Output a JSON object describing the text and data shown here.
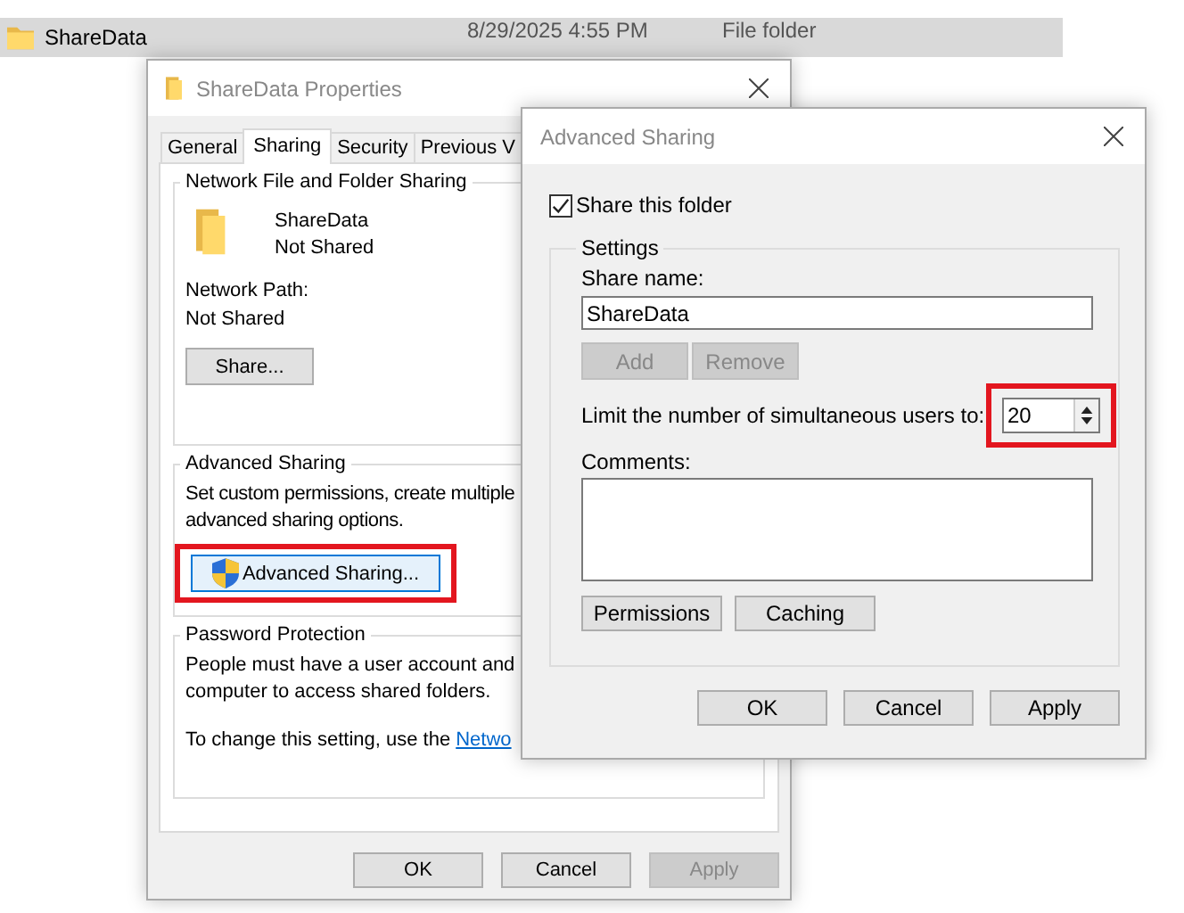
{
  "explorer_row": {
    "name": "ShareData",
    "date": "8/29/2025 4:55 PM",
    "type": "File folder",
    "selected": true
  },
  "properties_window": {
    "title": "ShareData Properties",
    "active": false,
    "tabs": [
      {
        "label": "General",
        "selected": false
      },
      {
        "label": "Sharing",
        "selected": true
      },
      {
        "label": "Security",
        "selected": false
      },
      {
        "label": "Previous V",
        "selected": false
      }
    ],
    "network_group": {
      "title": "Network File and Folder Sharing",
      "folder_name": "ShareData",
      "status": "Not Shared",
      "path_label": "Network Path:",
      "path_value": "Not Shared",
      "button": "Share..."
    },
    "advanced_group": {
      "title": "Advanced Sharing",
      "description": [
        "Set custom permissions, create multiple",
        "advanced sharing options."
      ],
      "button": "Advanced Sharing...",
      "highlighted": true
    },
    "password_group": {
      "title": "Password Protection",
      "description": [
        "People must have a user account and",
        "computer to access shared folders."
      ],
      "link_prefix": "To change this setting, use the",
      "link": "Netwo"
    },
    "buttons": [
      {
        "label": "OK",
        "disabled": false
      },
      {
        "label": "Cancel",
        "disabled": false
      },
      {
        "label": "Apply",
        "disabled": true
      }
    ]
  },
  "advanced_window": {
    "title": "Advanced Sharing",
    "active": false,
    "share_checkbox": {
      "label": "Share this folder",
      "checked": true
    },
    "settings": {
      "title": "Settings",
      "share_name_label": "Share name:",
      "share_name_value": "ShareData",
      "name_buttons": [
        {
          "label": "Add",
          "disabled": true
        },
        {
          "label": "Remove",
          "disabled": true
        }
      ],
      "limit_label": "Limit the number of simultaneous users to:",
      "limit_value": "20",
      "limit_highlighted": true,
      "comments_label": "Comments:",
      "buttons": [
        {
          "label": "Permissions",
          "disabled": false
        },
        {
          "label": "Caching",
          "disabled": false
        }
      ]
    },
    "buttons": [
      {
        "label": "OK",
        "disabled": false
      },
      {
        "label": "Cancel",
        "disabled": false
      },
      {
        "label": "Apply",
        "disabled": false
      }
    ]
  }
}
